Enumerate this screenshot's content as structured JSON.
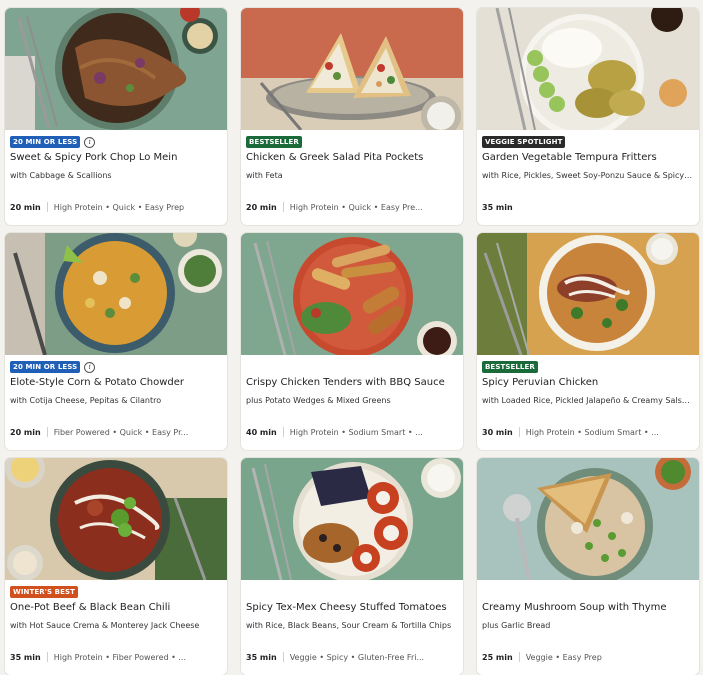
{
  "colors": {
    "badge_blue": "#1f5fb8",
    "badge_green": "#1b6b3a",
    "badge_dark": "#2a2a2a",
    "badge_orange": "#d0501e"
  },
  "cards": [
    {
      "badge": "20 MIN OR LESS",
      "badge_color": "#1f5fb8",
      "info_icon": true,
      "title": "Sweet & Spicy Pork Chop Lo Mein",
      "subtitle": "with Cabbage & Scallions",
      "time": "20 min",
      "tags": "High Protein • Quick • Easy Prep"
    },
    {
      "badge": "BESTSELLER",
      "badge_color": "#1b6b3a",
      "info_icon": false,
      "title": "Chicken & Greek Salad Pita Pockets",
      "subtitle": "with Feta",
      "time": "20 min",
      "tags": "High Protein • Quick • Easy Pre..."
    },
    {
      "badge": "VEGGIE SPOTLIGHT",
      "badge_color": "#2a2a2a",
      "info_icon": false,
      "title": "Garden Vegetable Tempura Fritters",
      "subtitle": "with Rice, Pickles, Sweet Soy-Ponzu Sauce & Spicy ...",
      "time": "35 min",
      "tags": ""
    },
    {
      "badge": "20 MIN OR LESS",
      "badge_color": "#1f5fb8",
      "info_icon": true,
      "title": "Elote-Style Corn & Potato Chowder",
      "subtitle": "with Cotija Cheese, Pepitas & Cilantro",
      "time": "20 min",
      "tags": "Fiber Powered • Quick • Easy Pr..."
    },
    {
      "badge": "",
      "badge_color": "",
      "info_icon": false,
      "title": "Crispy Chicken Tenders with BBQ Sauce",
      "subtitle": "plus Potato Wedges & Mixed Greens",
      "time": "40 min",
      "tags": "High Protein • Sodium Smart • ..."
    },
    {
      "badge": "BESTSELLER",
      "badge_color": "#1b6b3a",
      "info_icon": false,
      "title": "Spicy Peruvian Chicken",
      "subtitle": "with Loaded Rice, Pickled Jalapeño & Creamy Salsa...",
      "time": "30 min",
      "tags": "High Protein • Sodium Smart • ..."
    },
    {
      "badge": "WINTER'S BEST",
      "badge_color": "#d0501e",
      "info_icon": false,
      "title": "One-Pot Beef & Black Bean Chili",
      "subtitle": "with Hot Sauce Crema & Monterey Jack Cheese",
      "time": "35 min",
      "tags": "High Protein • Fiber Powered • ..."
    },
    {
      "badge": "",
      "badge_color": "",
      "info_icon": false,
      "title": "Spicy Tex-Mex Cheesy Stuffed Tomatoes",
      "subtitle": "with Rice, Black Beans, Sour Cream & Tortilla Chips",
      "time": "35 min",
      "tags": "Veggie • Spicy • Gluten-Free Fri..."
    },
    {
      "badge": "",
      "badge_color": "",
      "info_icon": false,
      "title": "Creamy Mushroom Soup with Thyme",
      "subtitle": "plus Garlic Bread",
      "time": "25 min",
      "tags": "Veggie • Easy Prep"
    }
  ]
}
